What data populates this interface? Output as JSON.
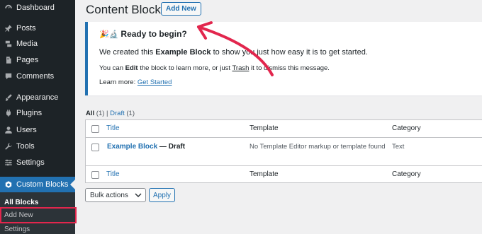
{
  "sidebar": {
    "items": [
      {
        "label": "Dashboard",
        "icon": "dashboard-icon"
      },
      {
        "label": "Posts",
        "icon": "pin-icon"
      },
      {
        "label": "Media",
        "icon": "media-icon"
      },
      {
        "label": "Pages",
        "icon": "page-icon"
      },
      {
        "label": "Comments",
        "icon": "comment-icon"
      },
      {
        "label": "Appearance",
        "icon": "brush-icon"
      },
      {
        "label": "Plugins",
        "icon": "plugin-icon"
      },
      {
        "label": "Users",
        "icon": "user-icon"
      },
      {
        "label": "Tools",
        "icon": "wrench-icon"
      },
      {
        "label": "Settings",
        "icon": "sliders-icon"
      },
      {
        "label": "Custom Blocks",
        "icon": "custom-blocks-icon"
      }
    ],
    "submenu": [
      "All Blocks",
      "Add New",
      "Settings"
    ]
  },
  "header": {
    "title": "Content Blocks",
    "add_new": "Add New"
  },
  "notice": {
    "title": "Ready to begin?",
    "emoji": "🎉🔬",
    "line1_a": "We created this ",
    "line1_b": "Example Block",
    "line1_c": " to show you just how easy it is to get started.",
    "line2_a": "You can ",
    "line2_b": "Edit",
    "line2_c": " the block to learn more, or just ",
    "line2_d": "Trash",
    "line2_e": " it to dismiss this message.",
    "line3_a": "Learn more: ",
    "line3_link": "Get Started"
  },
  "filters": {
    "all": "All",
    "all_count": "(1)",
    "sep": "|",
    "draft": "Draft",
    "draft_count": "(1)"
  },
  "table": {
    "columns": [
      "Title",
      "Template",
      "Category"
    ],
    "rows": [
      {
        "title": "Example Block",
        "state": " — Draft",
        "template": "No Template Editor markup or template found",
        "category": "Text"
      }
    ]
  },
  "bulk": {
    "select": "Bulk actions",
    "apply": "Apply"
  },
  "colors": {
    "accent": "#2271b1",
    "sidebar": "#1d2327",
    "highlight": "#e2264d"
  }
}
